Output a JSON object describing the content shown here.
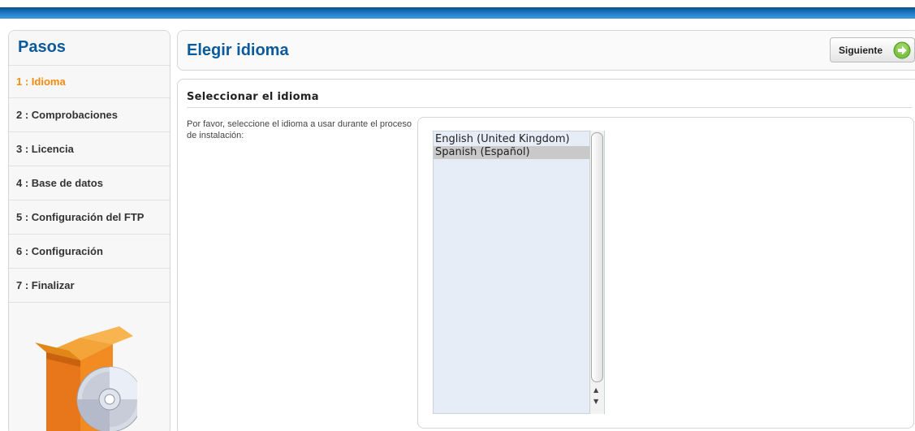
{
  "sidebar": {
    "title": "Pasos",
    "steps": [
      {
        "label": "1 : Idioma",
        "active": true
      },
      {
        "label": "2 : Comprobaciones"
      },
      {
        "label": "3 : Licencia"
      },
      {
        "label": "4 : Base de datos"
      },
      {
        "label": "5 : Configuración del FTP"
      },
      {
        "label": "6 : Configuración"
      },
      {
        "label": "7 : Finalizar"
      }
    ],
    "logo_icon": "installer-box-cd-icon"
  },
  "header": {
    "title": "Elegir idioma",
    "next_label": "Siguiente",
    "next_icon": "arrow-right-circle-icon"
  },
  "content": {
    "section_title": "Seleccionar el idioma",
    "instructions": "Por favor, seleccione el idioma a usar durante el proceso de instalación:",
    "languages": [
      "English (United Kingdom)",
      "Spanish (Español)"
    ],
    "selected_language": "Spanish (Español)"
  },
  "colors": {
    "accent_blue": "#0b5a9c",
    "active_step": "#f58a0e",
    "listbox_bg": "#e6edf6",
    "topbar": "#1a77c2"
  }
}
